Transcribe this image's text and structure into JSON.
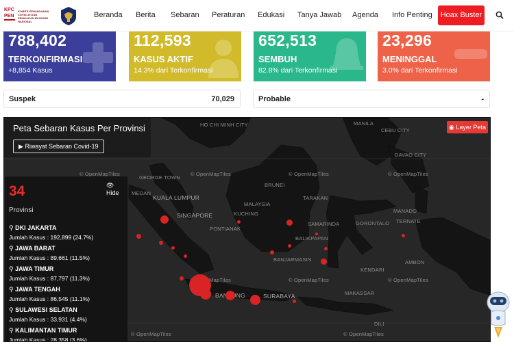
{
  "nav": {
    "logo_text": "KOMITE PENANGANAN COVID-19 DAN PEMULIHAN EKONOMI NASIONAL",
    "items": [
      "Beranda",
      "Berita",
      "Sebaran",
      "Peraturan",
      "Edukasi",
      "Tanya Jawab",
      "Agenda",
      "Info Penting"
    ],
    "hoax_label": "Hoax Buster"
  },
  "stats": [
    {
      "number": "788,402",
      "label": "TERKONFIRMASI",
      "sub": "+8,854 Kasus",
      "color": "#3b3f99"
    },
    {
      "number": "112,593",
      "label": "KASUS AKTIF",
      "sub": "14.3% dari Terkonfirmasi",
      "color": "#d2bb2b"
    },
    {
      "number": "652,513",
      "label": "SEMBUH",
      "sub": "82.8% dari Terkonfirmasi",
      "color": "#2ab78b"
    },
    {
      "number": "23,296",
      "label": "MENINGGAL",
      "sub": "3.0% dari Terkonfirmasi",
      "color": "#ee6249"
    }
  ],
  "suspek": {
    "label": "Suspek",
    "value": "70,029"
  },
  "probable": {
    "label": "Probable",
    "value": "-"
  },
  "map": {
    "title": "Peta Sebaran Kasus Per Provinsi",
    "riwayat_button": "Riwayat Sebaran Covid-19",
    "layer_button": "Layer Peta",
    "hide_label": "Hide",
    "province_count": "34",
    "province_label": "Provinsi",
    "provinces": [
      {
        "name": "DKI JAKARTA",
        "cases": "Jumlah Kasus : 192,899 (24.7%)"
      },
      {
        "name": "JAWA BARAT",
        "cases": "Jumlah Kasus : 89,661 (11.5%)"
      },
      {
        "name": "JAWA TIMUR",
        "cases": "Jumlah Kasus : 87,797 (11.3%)"
      },
      {
        "name": "JAWA TENGAH",
        "cases": "Jumlah Kasus : 86,545 (11.1%)"
      },
      {
        "name": "SULAWESI SELATAN",
        "cases": "Jumlah Kasus : 33,931 (4.4%)"
      },
      {
        "name": "KALIMANTAN TIMUR",
        "cases": "Jumlah Kasus : 28,358 (3.6%)"
      }
    ],
    "place_labels": [
      "HO CHI MINH CITY",
      "GEORGE TOWN",
      "MEDAN",
      "KUALA LUMPUR",
      "SINGAPORE",
      "MALAYSIA",
      "KUCHING",
      "BANJARMASIN",
      "BALIKPAPAN",
      "SAMARINDA",
      "TARAKAN",
      "GORONTALO",
      "TERNATE",
      "MANADO",
      "CEBU CITY",
      "DAVAO CITY",
      "MANILA",
      "AMBON",
      "BANDUNG",
      "SURABAYA",
      "BRUNEI",
      "PONTIANAK",
      "KENDARI",
      "MAKASSAR",
      "DILI"
    ],
    "attribution": "© OpenMapTiles"
  }
}
